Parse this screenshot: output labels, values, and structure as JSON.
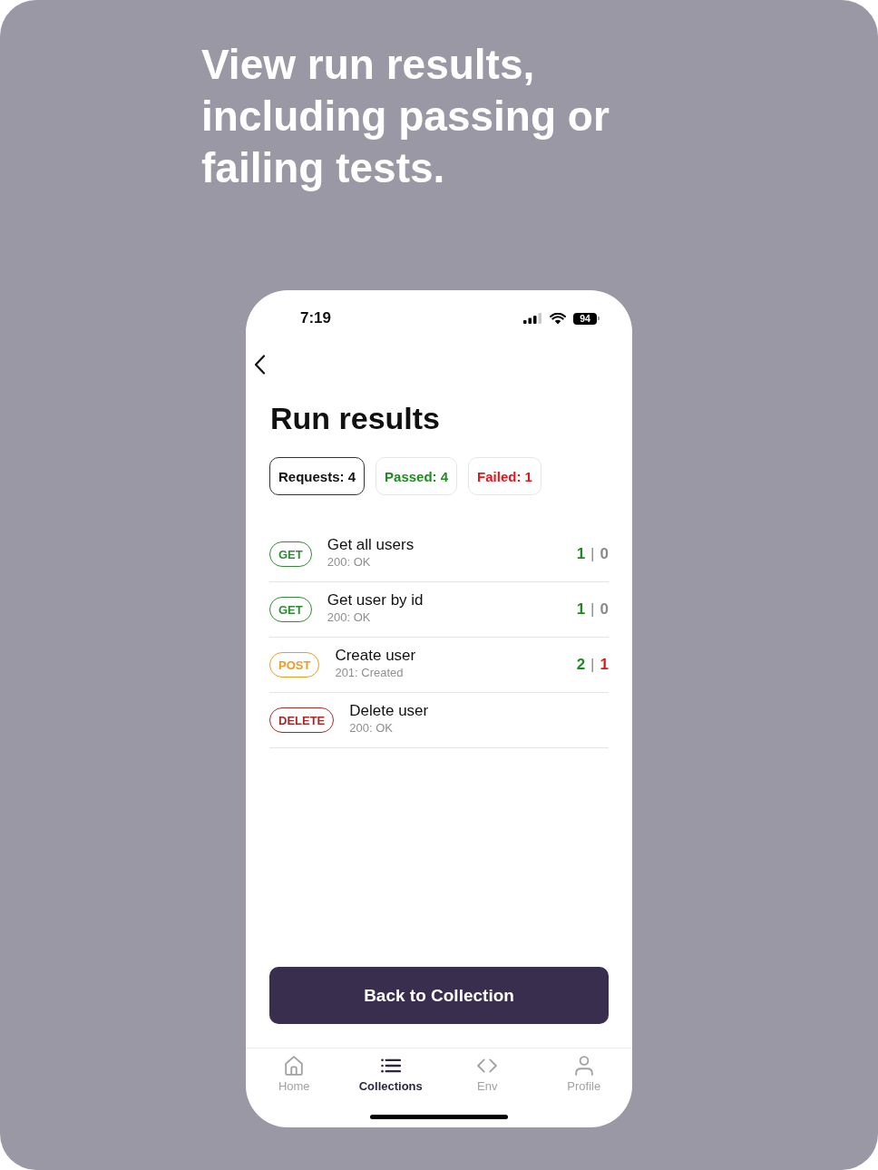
{
  "headline": "View run results, including passing or failing tests.",
  "status_bar": {
    "time": "7:19",
    "battery": "94"
  },
  "title": "Run results",
  "summary": [
    {
      "label": "Requests: 4",
      "kind": "total",
      "selected": true
    },
    {
      "label": "Passed: 4",
      "kind": "passed",
      "selected": false
    },
    {
      "label": "Failed: 1",
      "kind": "failed",
      "selected": false
    }
  ],
  "requests": [
    {
      "method": {
        "label": "GET",
        "color": "#2e8b34"
      },
      "name": "Get all users",
      "status": "200: OK",
      "results": {
        "passed": "1",
        "separator": "|",
        "failed": "0",
        "failing": false
      }
    },
    {
      "method": {
        "label": "GET",
        "color": "#2e8b34"
      },
      "name": "Get user by id",
      "status": "200: OK",
      "results": {
        "passed": "1",
        "separator": "|",
        "failed": "0",
        "failing": false
      }
    },
    {
      "method": {
        "label": "POST",
        "color": "#f29b1f"
      },
      "name": "Create user",
      "status": "201: Created",
      "results": {
        "passed": "2",
        "separator": "|",
        "failed": "1",
        "failing": true
      }
    },
    {
      "method": {
        "label": "DELETE",
        "color": "#a52a2a"
      },
      "name": "Delete user",
      "status": "200: OK"
    }
  ],
  "action_button": "Back to Collection",
  "tabs": [
    {
      "label": "Home",
      "selected": false
    },
    {
      "label": "Collections",
      "selected": true
    },
    {
      "label": "Env",
      "selected": false
    },
    {
      "label": "Profile",
      "selected": false
    }
  ]
}
